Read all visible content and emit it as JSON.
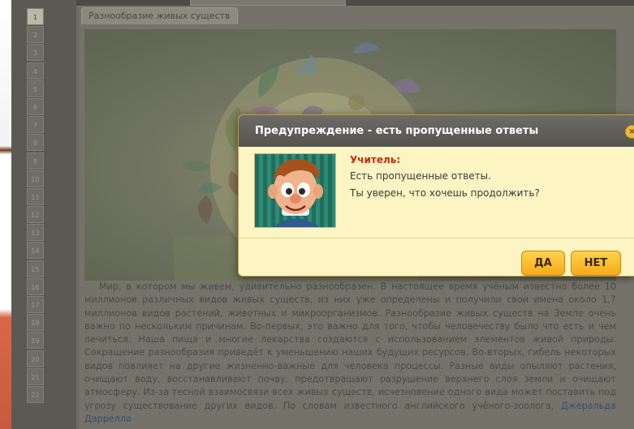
{
  "document": {
    "tab_label": "Разнообразие живых существ",
    "line_numbers": [
      "1",
      "2",
      "3",
      "4",
      "5",
      "6",
      "7",
      "8",
      "9",
      "10",
      "11",
      "12",
      "13",
      "14",
      "15",
      "16",
      "17",
      "18",
      "19",
      "20",
      "21",
      "22"
    ],
    "article_text": "Мир, в котором мы живем, удивительно разнообразен. В настоящее время учёным известно более 10 миллионов различных видов живых существ, из них уже определены и получили свои имена около 1,7 миллионов видов растений, животных и микроорганизмов. Разнообразие живых существ на Земле очень важно по нескольким причинам. Во-первых, это важно для того, чтобы человечеству было что есть и чем лечиться. Наша пища и многие лекарства создаются с использованием элементов живой природы. Сокращение разнообразия приведёт к уменьшению наших будущих ресурсов. Во-вторых, гибель некоторых видов повлияет на другие жизненно-важные для человека процессы. Разные виды опыляют растения, очищают воду, восстанавливают почву, предотвращают разрушение верхнего слоя земли и очищают атмосферу. Из-за тесной взаимосвязи всех живых существ, исчезновение одного вида может поставить под угрозу существование других видов. По словам известного английского учёного-зоолога, ",
    "article_link": "Джеральда Даррелла"
  },
  "dialog": {
    "title": "Предупреждение - есть пропущенные ответы",
    "close_icon": "×",
    "speaker": "Учитель:",
    "message_line1": "Есть пропущенные ответы.",
    "message_line2": "Ты уверен, что хочешь продолжить?",
    "yes_label": "ДА",
    "no_label": "НЕТ"
  },
  "colors": {
    "dialog_bg": "#fdf4c4",
    "header_bg": "#5e5c57",
    "speaker": "#c72b12",
    "button": "#f5b428"
  }
}
